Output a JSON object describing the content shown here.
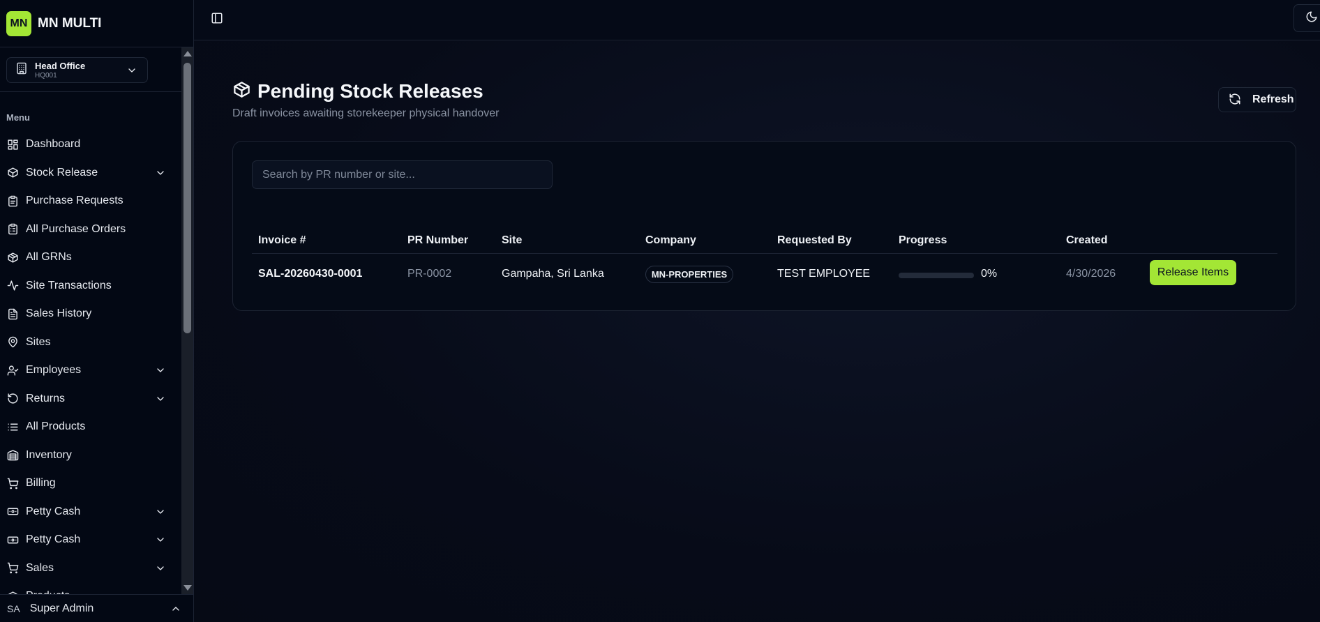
{
  "brand": {
    "logo_text": "MN",
    "name": "MN MULTI",
    "accent": "#a3e635"
  },
  "org": {
    "name": "Head Office",
    "code": "HQ001"
  },
  "sidebar": {
    "menu_label": "Menu",
    "items": [
      {
        "label": "Dashboard",
        "icon": "layout-dashboard-icon",
        "has_children": false
      },
      {
        "label": "Stock Release",
        "icon": "package-icon",
        "has_children": true
      },
      {
        "label": "Purchase Requests",
        "icon": "clipboard-icon",
        "has_children": false
      },
      {
        "label": "All Purchase Orders",
        "icon": "clipboard-list-icon",
        "has_children": false
      },
      {
        "label": "All GRNs",
        "icon": "box-icon",
        "has_children": false
      },
      {
        "label": "Site Transactions",
        "icon": "activity-icon",
        "has_children": false
      },
      {
        "label": "Sales History",
        "icon": "file-text-icon",
        "has_children": false
      },
      {
        "label": "Sites",
        "icon": "map-pin-icon",
        "has_children": false
      },
      {
        "label": "Employees",
        "icon": "user-check-icon",
        "has_children": true
      },
      {
        "label": "Returns",
        "icon": "rotate-ccw-icon",
        "has_children": true
      },
      {
        "label": "All Products",
        "icon": "list-icon",
        "has_children": false
      },
      {
        "label": "Inventory",
        "icon": "warehouse-icon",
        "has_children": false
      },
      {
        "label": "Billing",
        "icon": "shopping-cart-icon",
        "has_children": false
      },
      {
        "label": "Petty Cash",
        "icon": "banknote-icon",
        "has_children": true
      },
      {
        "label": "Petty Cash",
        "icon": "banknote-icon",
        "has_children": true
      },
      {
        "label": "Sales",
        "icon": "shopping-cart-icon",
        "has_children": true
      },
      {
        "label": "Products",
        "icon": "package-icon",
        "has_children": true
      }
    ]
  },
  "user": {
    "initials": "SA",
    "name": "Super Admin"
  },
  "page": {
    "title": "Pending Stock Releases",
    "subtitle": "Draft invoices awaiting storekeeper physical handover",
    "refresh_label": "Refresh"
  },
  "search": {
    "placeholder": "Search by PR number or site...",
    "value": ""
  },
  "table": {
    "columns": [
      "Invoice #",
      "PR Number",
      "Site",
      "Company",
      "Requested By",
      "Progress",
      "Created"
    ],
    "rows": [
      {
        "invoice": "SAL-20260430-0001",
        "pr_number": "PR-0002",
        "site": "Gampaha, Sri Lanka",
        "company": "MN-PROPERTIES",
        "requested_by": "TEST EMPLOYEE",
        "progress": 0,
        "progress_label": "0%",
        "created": "4/30/2026",
        "action_label": "Release Items"
      }
    ]
  }
}
